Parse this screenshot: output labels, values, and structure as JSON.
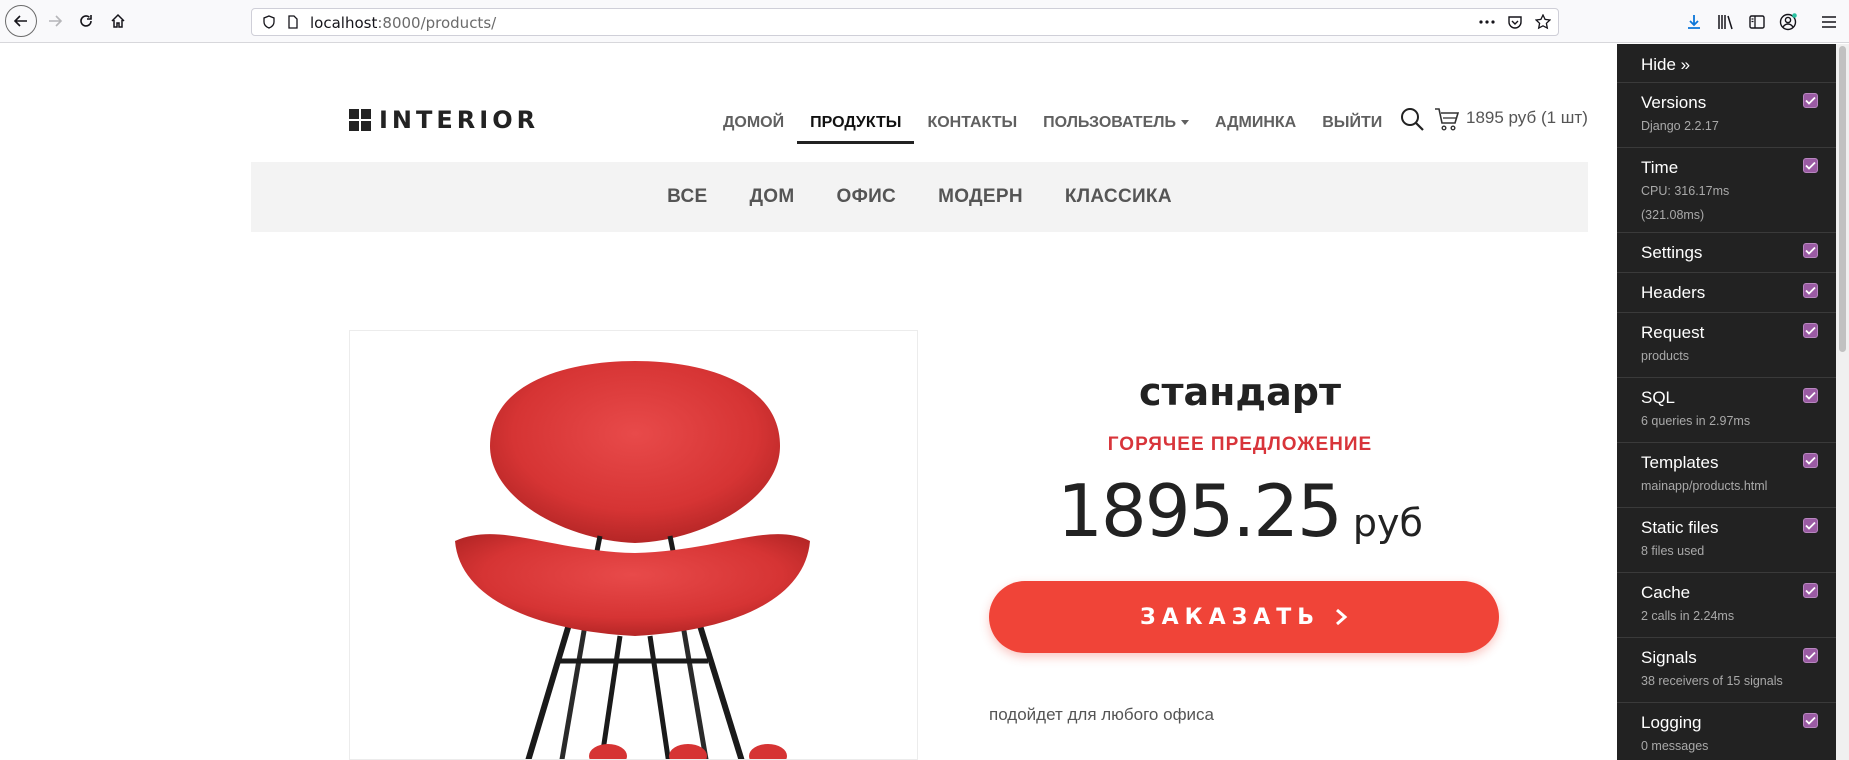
{
  "browser": {
    "url_host": "localhost",
    "url_rest": ":8000/products/"
  },
  "site": {
    "logo_text": "INTERIOR",
    "nav": [
      {
        "label": "ДОМОЙ"
      },
      {
        "label": "ПРОДУКТЫ",
        "active": true
      },
      {
        "label": "КОНТАКТЫ"
      },
      {
        "label": "ПОЛЬЗОВАТЕЛЬ"
      },
      {
        "label": "АДМИНКА"
      },
      {
        "label": "ВЫЙТИ"
      }
    ],
    "cart_text": "1895 руб (1 шт)",
    "categories": [
      "ВСЕ",
      "ДОМ",
      "ОФИС",
      "МОДЕРН",
      "КЛАССИКА"
    ]
  },
  "product": {
    "title": "стандарт",
    "hot_label": "ГОРЯЧЕЕ ПРЕДЛОЖЕНИЕ",
    "price": "1895.25",
    "currency": "руб",
    "order_label": "ЗАКАЗАТЬ",
    "description": "подойдет для любого офиса"
  },
  "debug_toolbar": {
    "hide_label": "Hide »",
    "panels": [
      {
        "title": "Versions",
        "sub": "Django 2.2.17"
      },
      {
        "title": "Time",
        "sub": "CPU: 316.17ms",
        "sub2": "(321.08ms)"
      },
      {
        "title": "Settings",
        "sub": ""
      },
      {
        "title": "Headers",
        "sub": ""
      },
      {
        "title": "Request",
        "sub": "products"
      },
      {
        "title": "SQL",
        "sub": "6 queries in 2.97ms"
      },
      {
        "title": "Templates",
        "sub": "mainapp/products.html"
      },
      {
        "title": "Static files",
        "sub": "8 files used"
      },
      {
        "title": "Cache",
        "sub": "2 calls in 2.24ms"
      },
      {
        "title": "Signals",
        "sub": "38 receivers of 15 signals"
      },
      {
        "title": "Logging",
        "sub": "0 messages"
      }
    ]
  },
  "colors": {
    "accent_red": "#f04438",
    "hot_red": "#d8343a",
    "toolbar_bg": "#222222",
    "checkbox": "#9a5ba3"
  }
}
